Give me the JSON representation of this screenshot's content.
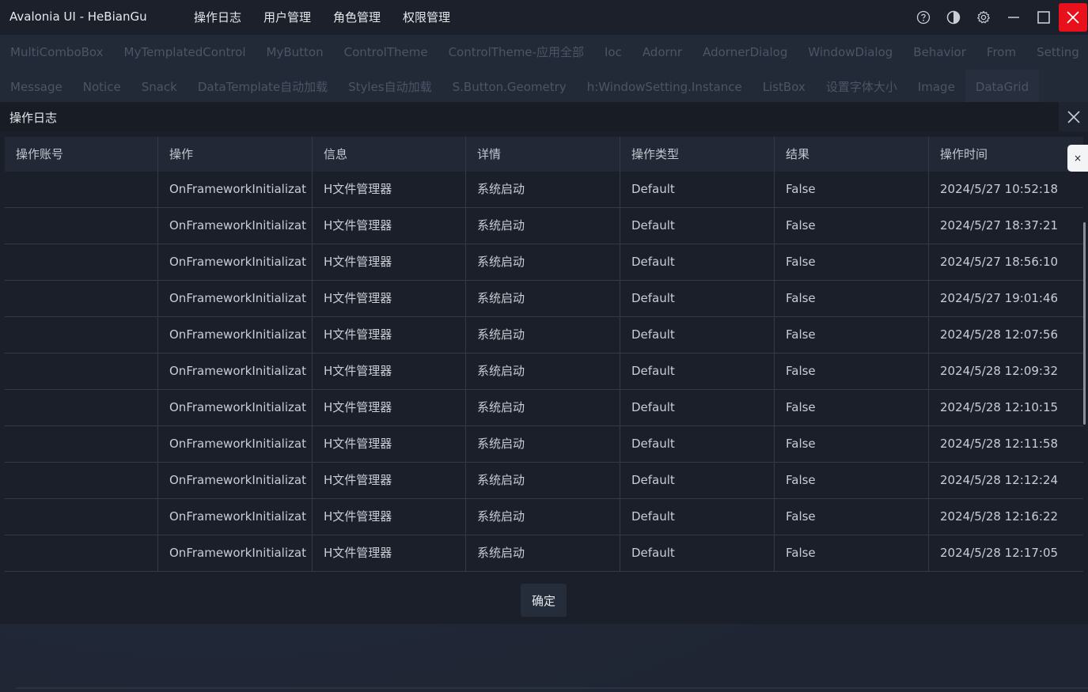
{
  "app": {
    "title": "Avalonia UI - HeBianGu",
    "menu": [
      "操作日志",
      "用户管理",
      "角色管理",
      "权限管理"
    ]
  },
  "window_controls": [
    "help-icon",
    "theme-icon",
    "gear-icon",
    "minimize-icon",
    "maximize-icon",
    "close-icon"
  ],
  "tabs_row1": [
    "MultiComboBox",
    "MyTemplatedControl",
    "MyButton",
    "ControlTheme",
    "ControlTheme-应用全部",
    "Ioc",
    "Adornr",
    "AdornerDialog",
    "WindowDialog",
    "Behavior",
    "From",
    "Setting"
  ],
  "tabs_row2": [
    "Message",
    "Notice",
    "Snack",
    "DataTemplate自动加载",
    "Styles自动加载",
    "S.Button.Geometry",
    "h:WindowSetting.Instance",
    "ListBox",
    "设置字体大小",
    "Image",
    "DataGrid"
  ],
  "active_tab": "DataGrid",
  "dialog": {
    "title": "操作日志",
    "confirm_label": "确定",
    "side_close_label": "×",
    "columns": [
      "操作账号",
      "操作",
      "信息",
      "详情",
      "操作类型",
      "结果",
      "操作时间"
    ],
    "rows": [
      [
        "",
        "OnFrameworkInitializat",
        "H文件管理器",
        "系统启动",
        "Default",
        "False",
        "2024/5/27 10:52:18"
      ],
      [
        "",
        "OnFrameworkInitializat",
        "H文件管理器",
        "系统启动",
        "Default",
        "False",
        "2024/5/27 18:37:21"
      ],
      [
        "",
        "OnFrameworkInitializat",
        "H文件管理器",
        "系统启动",
        "Default",
        "False",
        "2024/5/27 18:56:10"
      ],
      [
        "",
        "OnFrameworkInitializat",
        "H文件管理器",
        "系统启动",
        "Default",
        "False",
        "2024/5/27 19:01:46"
      ],
      [
        "",
        "OnFrameworkInitializat",
        "H文件管理器",
        "系统启动",
        "Default",
        "False",
        "2024/5/28 12:07:56"
      ],
      [
        "",
        "OnFrameworkInitializat",
        "H文件管理器",
        "系统启动",
        "Default",
        "False",
        "2024/5/28 12:09:32"
      ],
      [
        "",
        "OnFrameworkInitializat",
        "H文件管理器",
        "系统启动",
        "Default",
        "False",
        "2024/5/28 12:10:15"
      ],
      [
        "",
        "OnFrameworkInitializat",
        "H文件管理器",
        "系统启动",
        "Default",
        "False",
        "2024/5/28 12:11:58"
      ],
      [
        "",
        "OnFrameworkInitializat",
        "H文件管理器",
        "系统启动",
        "Default",
        "False",
        "2024/5/28 12:12:24"
      ],
      [
        "",
        "OnFrameworkInitializat",
        "H文件管理器",
        "系统启动",
        "Default",
        "False",
        "2024/5/28 12:16:22"
      ],
      [
        "",
        "OnFrameworkInitializat",
        "H文件管理器",
        "系统启动",
        "Default",
        "False",
        "2024/5/28 12:17:05"
      ]
    ]
  },
  "colors": {
    "accent_close": "#e8111b",
    "background": "#1f2533",
    "tab_text_inactive": "#4c5567"
  }
}
